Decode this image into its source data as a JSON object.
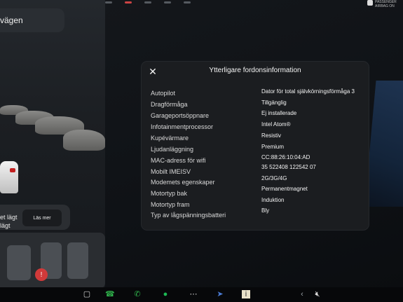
{
  "nav": {
    "destination_label": "vägen"
  },
  "passenger_airbag": {
    "label_line1": "PASSENGER",
    "label_line2": "AIRBAG ON"
  },
  "left_panel": {
    "mode_text_line1": "et lägt",
    "mode_text_line2": "lägt",
    "more_button": "Läs mer"
  },
  "dialog": {
    "title": "Ytterligare fordonsinformation",
    "close_icon": "close-icon",
    "rows": [
      {
        "label": "Autopilot",
        "value": "Dator för total självkörningsförmåga 3"
      },
      {
        "label": "Dragförmåga",
        "value": "Tillgänglig"
      },
      {
        "label": "Garageportsöppnare",
        "value": "Ej installerade"
      },
      {
        "label": "Infotainmentprocessor",
        "value": "Intel Atom®"
      },
      {
        "label": "Kupévärmare",
        "value": "Resistiv"
      },
      {
        "label": "Ljudanläggning",
        "value": "Premium"
      },
      {
        "label": "MAC-adress för wifi",
        "value": "CC:88:26:10:04:AD"
      },
      {
        "label": "Mobilt IMEISV",
        "value": "35 522408 122542 07"
      },
      {
        "label": "Modemets egenskaper",
        "value": "2G/3G/4G"
      },
      {
        "label": "Motortyp bak",
        "value": "Permanentmagnet"
      },
      {
        "label": "Motortyp fram",
        "value": "Induktion"
      },
      {
        "label": "Typ av lågspänningsbatteri",
        "value": "Bly"
      }
    ]
  },
  "dock": {
    "icons": [
      "car-icon",
      "phone-icon",
      "spotify-icon",
      "more-icon",
      "navigation-icon",
      "info-icon",
      "volume-muted-icon"
    ]
  },
  "colors": {
    "background": "#0c0e12",
    "dialog": "#1b1d20",
    "alert": "#d13a3a"
  }
}
